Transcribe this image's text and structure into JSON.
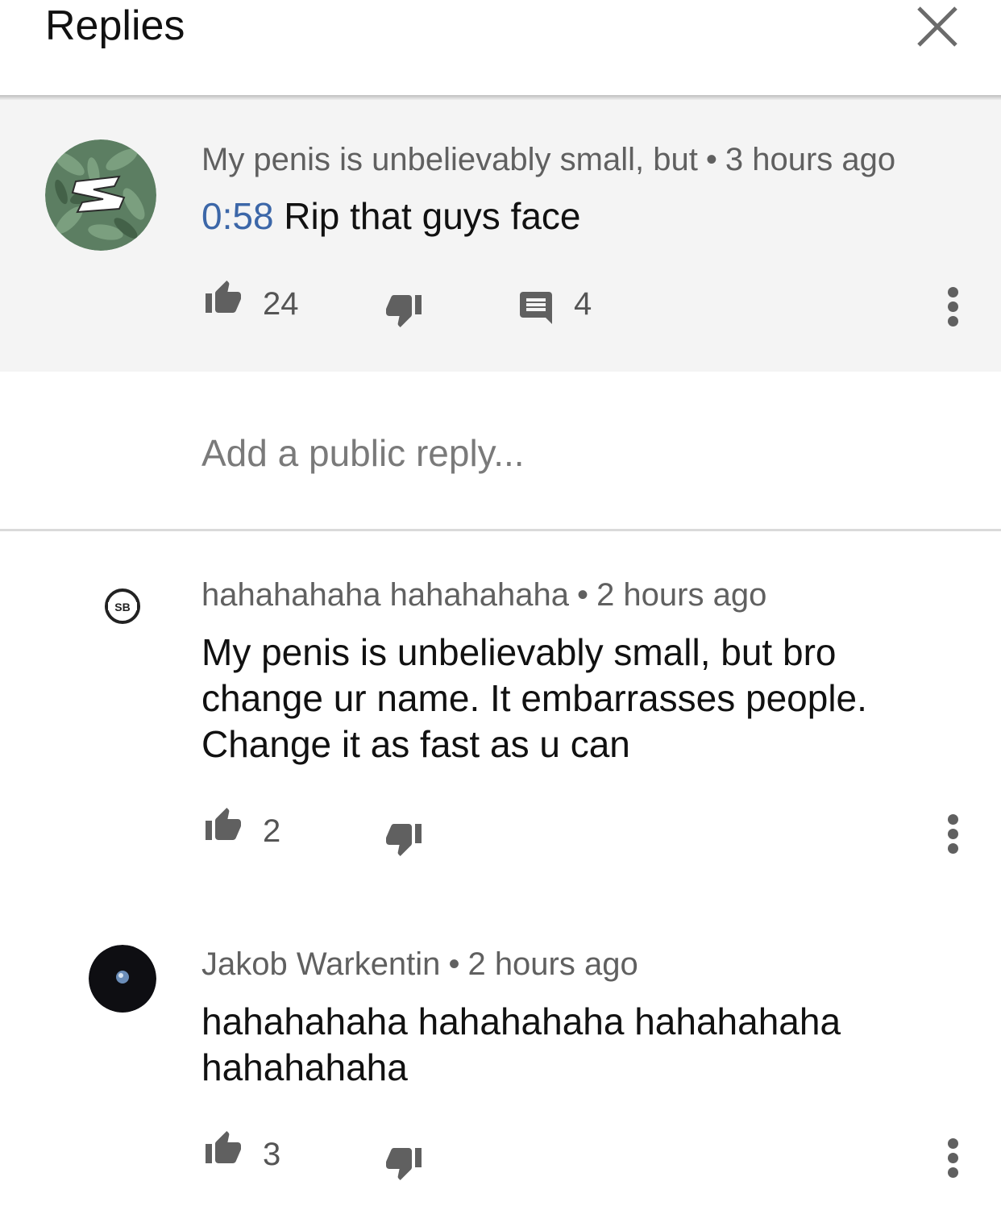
{
  "header": {
    "title": "Replies",
    "close_icon": "close-icon"
  },
  "parent_comment": {
    "author": "My penis is unbelievably small, but",
    "separator": "•",
    "time": "3 hours ago",
    "timestamp_link": "0:58",
    "text": " Rip that guys face",
    "likes": "24",
    "replies": "4"
  },
  "reply_box": {
    "placeholder": "Add a public reply..."
  },
  "replies": [
    {
      "author": "hahahahaha hahahahaha",
      "separator": "•",
      "time": "2 hours ago",
      "text": "My penis is unbelievably small, but bro change ur name. It embarrasses people. Change it as fast as u can",
      "likes": "2"
    },
    {
      "author": "Jakob Warkentin",
      "separator": "•",
      "time": "2 hours ago",
      "text": "hahahahaha hahahahaha hahahahaha hahahahaha",
      "likes": "3"
    }
  ],
  "colors": {
    "timestamp_link": "#3c67a8",
    "meta_text": "#606060",
    "highlight_bg": "#f4f4f4"
  }
}
